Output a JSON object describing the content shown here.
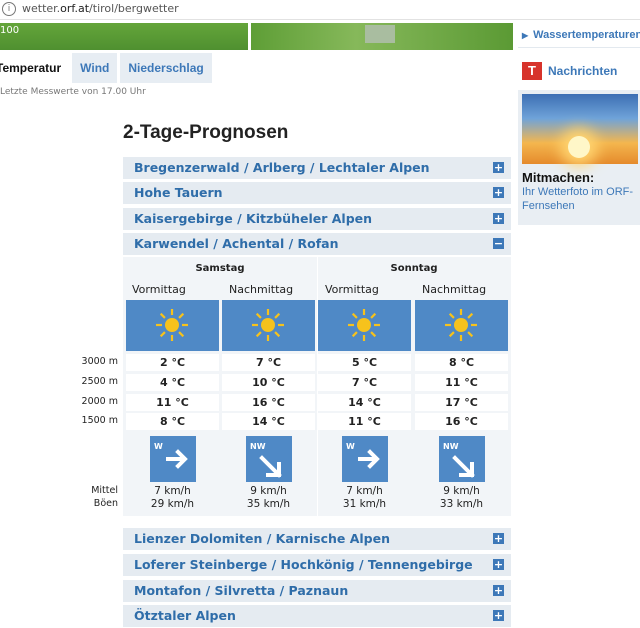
{
  "browser": {
    "url_plain": "wetter.",
    "url_host": "orf.at",
    "url_path": "/tirol/bergwetter"
  },
  "map": {
    "corner_label": "100"
  },
  "tabs": [
    {
      "label": "Temperatur",
      "active": true
    },
    {
      "label": "Wind",
      "active": false
    },
    {
      "label": "Niederschlag",
      "active": false
    }
  ],
  "note": "Letzte Messwerte von 17.00 Uhr",
  "sidebar": {
    "link1": "Wassertemperaturen",
    "link2": "Nachrichten",
    "link2_icon": "T",
    "promo_title": "Mitmachen:",
    "promo_text": "Ihr Wetterfoto im ORF-Fernsehen"
  },
  "main": {
    "title": "2-Tage-Prognosen",
    "regions_top": [
      {
        "label": "Bregenzerwald / Arlberg / Lechtaler Alpen",
        "state": "+"
      },
      {
        "label": "Hohe Tauern",
        "state": "+"
      },
      {
        "label": "Kaisergebirge / Kitzbüheler Alpen",
        "state": "+"
      },
      {
        "label": "Karwendel / Achental / Rofan",
        "state": "−"
      }
    ],
    "regions_bottom": [
      {
        "label": "Lienzer Dolomiten / Karnische Alpen",
        "state": "+"
      },
      {
        "label": "Loferer Steinberge / Hochkönig / Tennengebirge",
        "state": "+"
      },
      {
        "label": "Montafon / Silvretta / Paznaun",
        "state": "+"
      },
      {
        "label": "Ötztaler Alpen",
        "state": "+"
      }
    ],
    "forecast": {
      "days": [
        "Samstag",
        "Sonntag"
      ],
      "periods": [
        "Vormittag",
        "Nachmittag",
        "Vormittag",
        "Nachmittag"
      ],
      "weather_icon": "sun-icon",
      "altitudes": [
        "3000 m",
        "2500 m",
        "2000 m",
        "1500 m"
      ],
      "temps": [
        [
          "2 °C",
          "7 °C",
          "5 °C",
          "8 °C"
        ],
        [
          "4 °C",
          "10 °C",
          "7 °C",
          "11 °C"
        ],
        [
          "11 °C",
          "16 °C",
          "14 °C",
          "17 °C"
        ],
        [
          "8 °C",
          "14 °C",
          "11 °C",
          "16 °C"
        ]
      ],
      "wind_dirs": [
        "W",
        "NW",
        "W",
        "NW"
      ],
      "mittel_label": "Mittel",
      "boeen_label": "Böen",
      "mittel": [
        "7 km/h",
        "9 km/h",
        "7 km/h",
        "9 km/h"
      ],
      "boeen": [
        "29 km/h",
        "35 km/h",
        "31 km/h",
        "33 km/h"
      ]
    }
  },
  "colors": {
    "accent": "#3d78b8",
    "tile": "#4f89c6",
    "header_bg": "#e5ebf1",
    "panel_bg": "#f2f5f8",
    "sun": "#f6c21c"
  }
}
